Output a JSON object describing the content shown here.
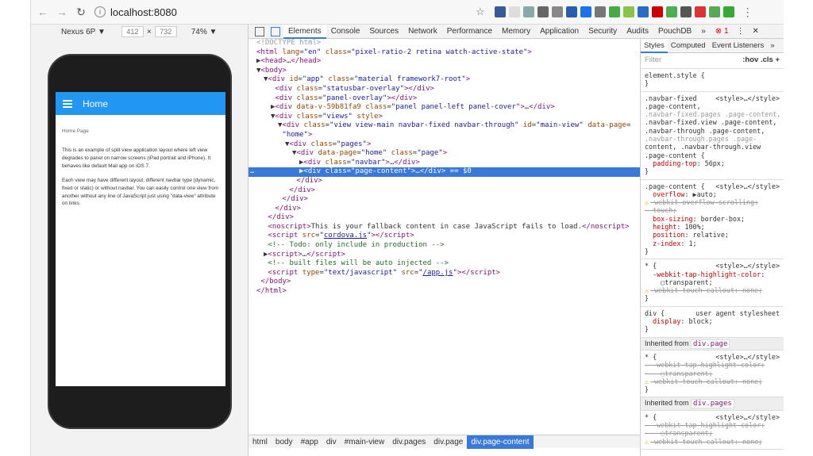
{
  "browser": {
    "url": "localhost:8080",
    "back": "←",
    "forward": "→",
    "reload": "↻",
    "info": "i",
    "star": "☆",
    "menu": "⋮",
    "extension_colors": [
      "#3b5998",
      "#ddd",
      "#8aa",
      "#666",
      "#888",
      "#2a5db0",
      "#1a73e8",
      "#777",
      "#4a4",
      "#8bc34a",
      "#2b6cc4",
      "#c00",
      "#4caf50",
      "#555",
      "#d33",
      "#5a5",
      "#3a3"
    ]
  },
  "device": {
    "model": "Nexus 6P ▼",
    "width": "412",
    "times": "×",
    "height": "732",
    "zoom": "74% ▼"
  },
  "phone": {
    "title": "Home",
    "page_label": "Home Page",
    "para1": "This is an example of split view application layout where left view degrades to panel on narrow screens (iPad portrait and iPhone). It behaves like default Mail app on iOS 7.",
    "para2": "Each view may have different layout, different navbar type (dynamic, fixed or static) or without navbar. You can easily control one view from another without any line of JavaScript just using \"data-view\" attribute on links."
  },
  "devtools": {
    "tabs": [
      "Elements",
      "Console",
      "Sources",
      "Network",
      "Performance",
      "Memory",
      "Application",
      "Security",
      "Audits",
      "PouchDB",
      "»"
    ],
    "error_count": "⊗ 1",
    "more": "⋮",
    "close": "✕",
    "dom_lines": [
      {
        "indent": 0,
        "html": "<span class='dt'>&lt;!DOCTYPE html&gt;</span>"
      },
      {
        "indent": 0,
        "html": "<span class='tg'>&lt;html</span> <span class='an'>lang</span>=<span class='av'>\"en\"</span> <span class='an'>class</span>=<span class='av'>\"pixel-ratio-2 retina watch-active-state\"</span><span class='tg'>&gt;</span>"
      },
      {
        "indent": 0,
        "html": "▶<span class='tg'>&lt;head&gt;</span>…<span class='tg'>&lt;/head&gt;</span>"
      },
      {
        "indent": 0,
        "html": "▼<span class='tg'>&lt;body&gt;</span>"
      },
      {
        "indent": 1,
        "html": "▼<span class='tg'>&lt;div</span> <span class='an'>id</span>=<span class='av'>\"app\"</span> <span class='an'>class</span>=<span class='av'>\"material framework7-root\"</span><span class='tg'>&gt;</span>"
      },
      {
        "indent": 2,
        "html": " <span class='tg'>&lt;div</span> <span class='an'>class</span>=<span class='av'>\"statusbar-overlay\"</span><span class='tg'>&gt;&lt;/div&gt;</span>"
      },
      {
        "indent": 2,
        "html": " <span class='tg'>&lt;div</span> <span class='an'>class</span>=<span class='av'>\"panel-overlay\"</span><span class='tg'>&gt;&lt;/div&gt;</span>"
      },
      {
        "indent": 2,
        "html": "▶<span class='tg'>&lt;div</span> <span class='an'>data-v-59b81fa9</span> <span class='an'>class</span>=<span class='av'>\"panel panel-left panel-cover\"</span><span class='tg'>&gt;</span>…<span class='tg'>&lt;/div&gt;</span>"
      },
      {
        "indent": 2,
        "html": "▼<span class='tg'>&lt;div</span> <span class='an'>class</span>=<span class='av'>\"views\"</span> <span class='an'>style</span><span class='tg'>&gt;</span>"
      },
      {
        "indent": 3,
        "html": "▼<span class='tg'>&lt;div</span> <span class='an'>class</span>=<span class='av'>\"view view-main navbar-fixed navbar-through\"</span> <span class='an'>id</span>=<span class='av'>\"main-view\"</span> <span class='an'>data-page</span>="
      },
      {
        "indent": 3,
        "html": " <span class='av'>\"home\"</span><span class='tg'>&gt;</span>"
      },
      {
        "indent": 4,
        "html": "▼<span class='tg'>&lt;div</span> <span class='an'>class</span>=<span class='av'>\"pages\"</span><span class='tg'>&gt;</span>"
      },
      {
        "indent": 5,
        "html": "▼<span class='tg'>&lt;div</span> <span class='an'>data-page</span>=<span class='av'>\"home\"</span> <span class='an'>class</span>=<span class='av'>\"page\"</span><span class='tg'>&gt;</span>"
      },
      {
        "indent": 6,
        "html": "▶<span class='tg'>&lt;div</span> <span class='an'>class</span>=<span class='av'>\"navbar\"</span><span class='tg'>&gt;</span>…<span class='tg'>&lt;/div&gt;</span>"
      },
      {
        "indent": 6,
        "sel": true,
        "html": "▶<span class='tg'>&lt;div</span> <span class='an'>class</span>=<span class='av'>\"page-content\"</span><span class='tg'>&gt;</span>…<span class='tg'>&lt;/div&gt;</span> == $0"
      },
      {
        "indent": 5,
        "html": " <span class='tg'>&lt;/div&gt;</span>"
      },
      {
        "indent": 4,
        "html": " <span class='tg'>&lt;/div&gt;</span>"
      },
      {
        "indent": 3,
        "html": " <span class='tg'>&lt;/div&gt;</span>"
      },
      {
        "indent": 2,
        "html": " <span class='tg'>&lt;/div&gt;</span>"
      },
      {
        "indent": 1,
        "html": " <span class='tg'>&lt;/div&gt;</span>"
      },
      {
        "indent": 1,
        "html": " <span class='tg'>&lt;noscript&gt;</span>This is your fallback content in case JavaScript fails to load.<span class='tg'>&lt;/noscript&gt;</span>"
      },
      {
        "indent": 1,
        "html": " <span class='tg'>&lt;script</span> <span class='an'>src</span>=<span class='av'>\"<u>cordova.js</u>\"</span><span class='tg'>&gt;&lt;/script&gt;</span>"
      },
      {
        "indent": 1,
        "html": " <span class='cm'>&lt;!-- Todo: only include in production --&gt;</span>"
      },
      {
        "indent": 1,
        "html": "▶<span class='tg'>&lt;script&gt;</span>…<span class='tg'>&lt;/script&gt;</span>"
      },
      {
        "indent": 1,
        "html": " <span class='cm'>&lt;!-- built files will be auto injected --&gt;</span>"
      },
      {
        "indent": 1,
        "html": " <span class='tg'>&lt;script</span> <span class='an'>type</span>=<span class='av'>\"text/javascript\"</span> <span class='an'>src</span>=<span class='av'>\"<u>/app.js</u>\"</span><span class='tg'>&gt;&lt;/script&gt;</span>"
      },
      {
        "indent": 0,
        "html": " <span class='tg'>&lt;/body&gt;</span>"
      },
      {
        "indent": 0,
        "html": "<span class='tg'>&lt;/html&gt;</span>"
      }
    ],
    "breadcrumbs": [
      "html",
      "body",
      "#app",
      "div",
      "#main-view",
      "div.pages",
      "div.page",
      "div.page-content"
    ]
  },
  "styles_pane": {
    "tabs": [
      "Styles",
      "Computed",
      "Event Listeners",
      "»"
    ],
    "filter_placeholder": "Filter",
    "filter_controls": ":hov  .cls  +",
    "inherited_label": "Inherited from",
    "rules": [
      {
        "lines": [
          {
            "t": "element.style {"
          },
          {
            "t": "}"
          }
        ]
      },
      {
        "lines": [
          {
            "t": ".navbar-fixed",
            "src": "<style>…</style>"
          },
          {
            "t": ".page-content,"
          },
          {
            "t": ".navbar-fixed.pages .page-content,",
            "cls": "gray"
          },
          {
            "t": ".navbar-fixed.view .page-content,"
          },
          {
            "t": ".navbar-through .page-content,"
          },
          {
            "t": ".navbar-through.pages .page-",
            "cls": "gray"
          },
          {
            "t": "content, .navbar-through.view"
          },
          {
            "t": ".page-content {"
          },
          {
            "t": "  padding-top: 56px;",
            "prop": true
          },
          {
            "t": "}"
          }
        ]
      },
      {
        "lines": [
          {
            "t": ".page-content {",
            "src": "<style>…</style>"
          },
          {
            "t": "  overflow: ▶auto;",
            "prop": true
          },
          {
            "t": "-webkit-overflow-scrolling:",
            "warn": true,
            "strike": true
          },
          {
            "t": "  touch;",
            "strike": true
          },
          {
            "t": "  box-sizing: border-box;",
            "prop": true
          },
          {
            "t": "  height: 100%;",
            "prop": true
          },
          {
            "t": "  position: relative;",
            "prop": true
          },
          {
            "t": "  z-index: 1;",
            "prop": true
          },
          {
            "t": "}"
          }
        ]
      },
      {
        "lines": [
          {
            "t": "* {",
            "src": "<style>…</style>"
          },
          {
            "t": "  -webkit-tap-highlight-color:",
            "prop": true
          },
          {
            "t": "    ▢transparent;"
          },
          {
            "t": "-webkit-touch-callout: none;",
            "warn": true,
            "strike": true
          },
          {
            "t": "}"
          }
        ]
      },
      {
        "lines": [
          {
            "t": "div {",
            "src": "user agent stylesheet"
          },
          {
            "t": "  display: block;",
            "prop": true
          },
          {
            "t": "}"
          }
        ]
      },
      {
        "inherit": "div.page"
      },
      {
        "lines": [
          {
            "t": "* {",
            "src": "<style>…</style>"
          },
          {
            "t": "  -webkit-tap-highlight-color:",
            "strike": true
          },
          {
            "t": "    ▢transparent;",
            "strike": true
          },
          {
            "t": "-webkit-touch-callout: none;",
            "warn": true,
            "strike": true
          },
          {
            "t": "}"
          }
        ]
      },
      {
        "inherit": "div.pages"
      },
      {
        "lines": [
          {
            "t": "* {",
            "src": "<style>…</style>"
          },
          {
            "t": "  -webkit-tap-highlight-color:",
            "strike": true
          },
          {
            "t": "    ▢transparent;",
            "strike": true
          },
          {
            "t": "-webkit-touch-callout: none;",
            "warn": true,
            "strike": true
          }
        ]
      }
    ]
  }
}
